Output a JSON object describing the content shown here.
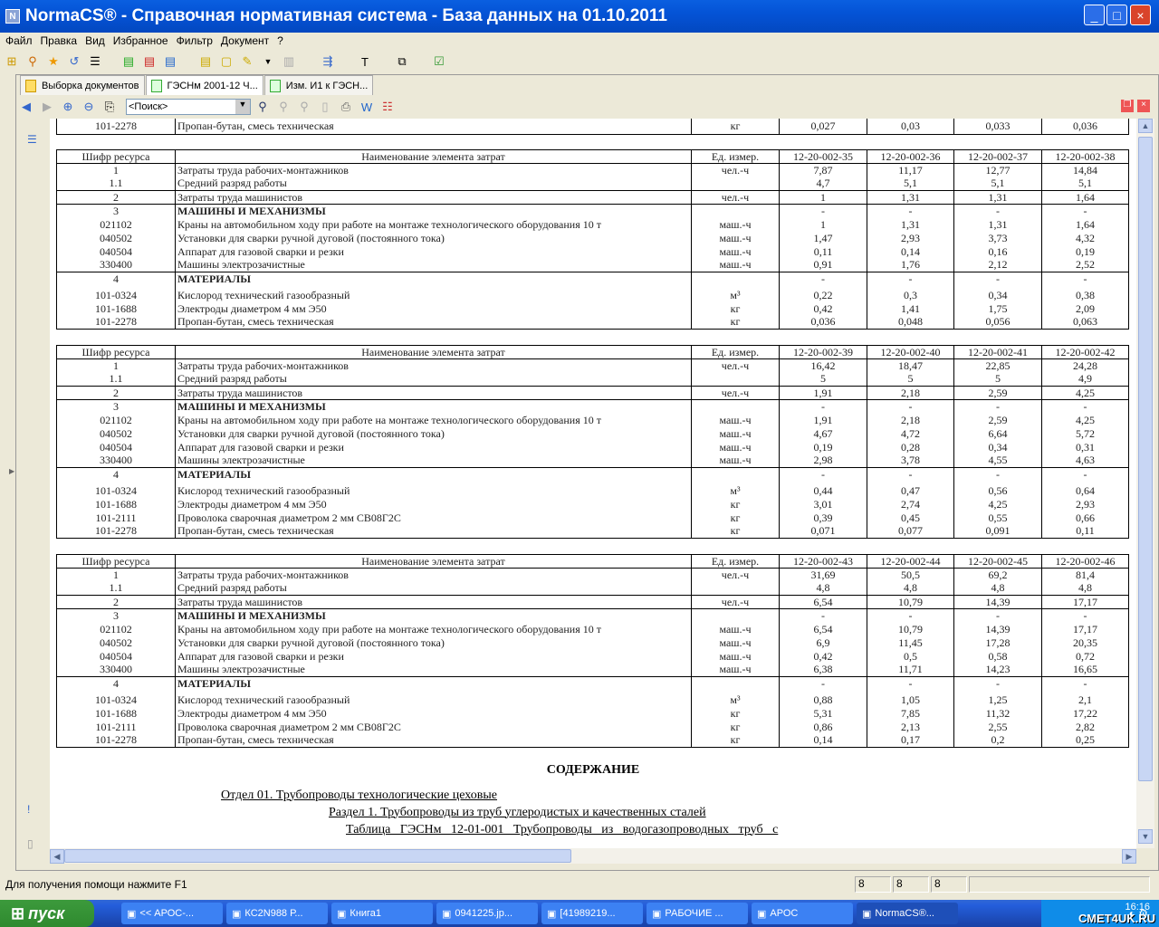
{
  "window": {
    "title": "NormaCS® - Справочная нормативная система - База данных на 01.10.2011",
    "minimize": "_",
    "maximize": "□",
    "close": "×"
  },
  "menu": [
    "Файл",
    "Правка",
    "Вид",
    "Избранное",
    "Фильтр",
    "Документ",
    "?"
  ],
  "tabs": [
    "Выборка документов",
    "ГЭСНм 2001-12 Ч...",
    "Изм. И1  к ГЭСН..."
  ],
  "search": {
    "value": "<Поиск>"
  },
  "headers": {
    "code": "Шифр ресурса",
    "name": "Наименование элемента затрат",
    "unit": "Ед. измер."
  },
  "partial_row": {
    "code": "101-2278",
    "name": "Пропан-бутан, смесь техническая",
    "unit": "кг",
    "vals": [
      "0,027",
      "0,03",
      "0,033",
      "0,036"
    ]
  },
  "blocks": [
    {
      "codes": [
        "12-20-002-35",
        "12-20-002-36",
        "12-20-002-37",
        "12-20-002-38"
      ],
      "groups": [
        [
          {
            "code": "1",
            "name": "Затраты труда рабочих-монтажников",
            "unit": "чел.-ч",
            "vals": [
              "7,87",
              "11,17",
              "12,77",
              "14,84"
            ]
          },
          {
            "code": "1.1",
            "name": "Средний разряд работы",
            "unit": "",
            "vals": [
              "4,7",
              "5,1",
              "5,1",
              "5,1"
            ]
          }
        ],
        [
          {
            "code": "2",
            "name": "Затраты труда машинистов",
            "unit": "чел.-ч",
            "vals": [
              "1",
              "1,31",
              "1,31",
              "1,64"
            ]
          }
        ],
        [
          {
            "code": "3",
            "name": "МАШИНЫ И МЕХАНИЗМЫ",
            "unit": "",
            "bold": true,
            "vals": [
              "-",
              "-",
              "-",
              "-"
            ]
          },
          {
            "code": "021102",
            "name": "Краны на автомобильном ходу при работе на монтаже технологического оборудования 10 т",
            "unit": "маш.-ч",
            "vals": [
              "1",
              "1,31",
              "1,31",
              "1,64"
            ]
          },
          {
            "code": "040502",
            "name": "Установки для сварки ручной дуговой (постоянного тока)",
            "unit": "маш.-ч",
            "vals": [
              "1,47",
              "2,93",
              "3,73",
              "4,32"
            ]
          },
          {
            "code": "040504",
            "name": "Аппарат для газовой сварки и резки",
            "unit": "маш.-ч",
            "vals": [
              "0,11",
              "0,14",
              "0,16",
              "0,19"
            ]
          },
          {
            "code": "330400",
            "name": "Машины электрозачистные",
            "unit": "маш.-ч",
            "vals": [
              "0,91",
              "1,76",
              "2,12",
              "2,52"
            ]
          }
        ],
        [
          {
            "code": "4",
            "name": "МАТЕРИАЛЫ",
            "unit": "",
            "bold": true,
            "vals": [
              "-",
              "-",
              "-",
              "-"
            ]
          },
          {
            "code": "101-0324",
            "name": "Кислород технический газообразный",
            "unit": "м³",
            "tall": true,
            "vals": [
              "0,22",
              "0,3",
              "0,34",
              "0,38"
            ]
          },
          {
            "code": "101-1688",
            "name": "Электроды диаметром 4 мм Э50",
            "unit": "кг",
            "vals": [
              "0,42",
              "1,41",
              "1,75",
              "2,09"
            ]
          },
          {
            "code": "101-2278",
            "name": "Пропан-бутан, смесь техническая",
            "unit": "кг",
            "vals": [
              "0,036",
              "0,048",
              "0,056",
              "0,063"
            ]
          }
        ]
      ]
    },
    {
      "codes": [
        "12-20-002-39",
        "12-20-002-40",
        "12-20-002-41",
        "12-20-002-42"
      ],
      "groups": [
        [
          {
            "code": "1",
            "name": "Затраты труда рабочих-монтажников",
            "unit": "чел.-ч",
            "vals": [
              "16,42",
              "18,47",
              "22,85",
              "24,28"
            ]
          },
          {
            "code": "1.1",
            "name": "Средний разряд работы",
            "unit": "",
            "vals": [
              "5",
              "5",
              "5",
              "4,9"
            ]
          }
        ],
        [
          {
            "code": "2",
            "name": "Затраты труда машинистов",
            "unit": "чел.-ч",
            "vals": [
              "1,91",
              "2,18",
              "2,59",
              "4,25"
            ]
          }
        ],
        [
          {
            "code": "3",
            "name": "МАШИНЫ И МЕХАНИЗМЫ",
            "unit": "",
            "bold": true,
            "vals": [
              "-",
              "-",
              "-",
              "-"
            ]
          },
          {
            "code": "021102",
            "name": "Краны на автомобильном ходу при работе на монтаже технологического оборудования 10 т",
            "unit": "маш.-ч",
            "vals": [
              "1,91",
              "2,18",
              "2,59",
              "4,25"
            ]
          },
          {
            "code": "040502",
            "name": "Установки для сварки ручной дуговой (постоянного тока)",
            "unit": "маш.-ч",
            "vals": [
              "4,67",
              "4,72",
              "6,64",
              "5,72"
            ]
          },
          {
            "code": "040504",
            "name": "Аппарат для газовой сварки и резки",
            "unit": "маш.-ч",
            "vals": [
              "0,19",
              "0,28",
              "0,34",
              "0,31"
            ]
          },
          {
            "code": "330400",
            "name": "Машины электрозачистные",
            "unit": "маш.-ч",
            "vals": [
              "2,98",
              "3,78",
              "4,55",
              "4,63"
            ]
          }
        ],
        [
          {
            "code": "4",
            "name": "МАТЕРИАЛЫ",
            "unit": "",
            "bold": true,
            "vals": [
              "-",
              "-",
              "-",
              "-"
            ]
          },
          {
            "code": "101-0324",
            "name": "Кислород технический газообразный",
            "unit": "м³",
            "tall": true,
            "vals": [
              "0,44",
              "0,47",
              "0,56",
              "0,64"
            ]
          },
          {
            "code": "101-1688",
            "name": "Электроды диаметром 4 мм Э50",
            "unit": "кг",
            "vals": [
              "3,01",
              "2,74",
              "4,25",
              "2,93"
            ]
          },
          {
            "code": "101-2111",
            "name": "Проволока сварочная диаметром 2 мм СВ08Г2С",
            "unit": "кг",
            "vals": [
              "0,39",
              "0,45",
              "0,55",
              "0,66"
            ]
          },
          {
            "code": "101-2278",
            "name": "Пропан-бутан, смесь техническая",
            "unit": "кг",
            "vals": [
              "0,071",
              "0,077",
              "0,091",
              "0,11"
            ]
          }
        ]
      ]
    },
    {
      "codes": [
        "12-20-002-43",
        "12-20-002-44",
        "12-20-002-45",
        "12-20-002-46"
      ],
      "groups": [
        [
          {
            "code": "1",
            "name": "Затраты труда рабочих-монтажников",
            "unit": "чел.-ч",
            "vals": [
              "31,69",
              "50,5",
              "69,2",
              "81,4"
            ]
          },
          {
            "code": "1.1",
            "name": "Средний разряд работы",
            "unit": "",
            "vals": [
              "4,8",
              "4,8",
              "4,8",
              "4,8"
            ]
          }
        ],
        [
          {
            "code": "2",
            "name": "Затраты труда машинистов",
            "unit": "чел.-ч",
            "vals": [
              "6,54",
              "10,79",
              "14,39",
              "17,17"
            ]
          }
        ],
        [
          {
            "code": "3",
            "name": "МАШИНЫ И МЕХАНИЗМЫ",
            "unit": "",
            "bold": true,
            "vals": [
              "-",
              "-",
              "-",
              "-"
            ]
          },
          {
            "code": "021102",
            "name": "Краны на автомобильном ходу при работе на монтаже технологического оборудования 10 т",
            "unit": "маш.-ч",
            "vals": [
              "6,54",
              "10,79",
              "14,39",
              "17,17"
            ]
          },
          {
            "code": "040502",
            "name": "Установки для сварки ручной дуговой (постоянного тока)",
            "unit": "маш.-ч",
            "vals": [
              "6,9",
              "11,45",
              "17,28",
              "20,35"
            ]
          },
          {
            "code": "040504",
            "name": "Аппарат для газовой сварки и резки",
            "unit": "маш.-ч",
            "vals": [
              "0,42",
              "0,5",
              "0,58",
              "0,72"
            ]
          },
          {
            "code": "330400",
            "name": "Машины электрозачистные",
            "unit": "маш.-ч",
            "vals": [
              "6,38",
              "11,71",
              "14,23",
              "16,65"
            ]
          }
        ],
        [
          {
            "code": "4",
            "name": "МАТЕРИАЛЫ",
            "unit": "",
            "bold": true,
            "vals": [
              "-",
              "-",
              "-",
              "-"
            ]
          },
          {
            "code": "101-0324",
            "name": "Кислород технический газообразный",
            "unit": "м³",
            "tall": true,
            "vals": [
              "0,88",
              "1,05",
              "1,25",
              "2,1"
            ]
          },
          {
            "code": "101-1688",
            "name": "Электроды диаметром 4 мм Э50",
            "unit": "кг",
            "vals": [
              "5,31",
              "7,85",
              "11,32",
              "17,22"
            ]
          },
          {
            "code": "101-2111",
            "name": "Проволока сварочная диаметром 2 мм СВ08Г2С",
            "unit": "кг",
            "vals": [
              "0,86",
              "2,13",
              "2,55",
              "2,82"
            ]
          },
          {
            "code": "101-2278",
            "name": "Пропан-бутан, смесь техническая",
            "unit": "кг",
            "vals": [
              "0,14",
              "0,17",
              "0,2",
              "0,25"
            ]
          }
        ]
      ]
    }
  ],
  "toc": {
    "heading": "СОДЕРЖАНИЕ",
    "links": [
      "Отдел 01. Трубопроводы технологические цеховые",
      "Раздел 1. Трубопроводы из труб углеродистых и качественных сталей",
      "Таблица   ГЭСНм   12-01-001   Трубопроводы   из   водогазопроводных   труб   с"
    ]
  },
  "status": {
    "text": "Для получения помощи нажмите F1",
    "panes": [
      "8",
      "8",
      "8"
    ]
  },
  "taskbar": {
    "start": "пуск",
    "tasks": [
      "<< АРОС-...",
      "КС2N988 Р...",
      "Книга1",
      "0941225.jp...",
      "[41989219...",
      "РАБОЧИЕ ...",
      "АРОС",
      "NormaCS®..."
    ],
    "clock": "16:16",
    "watermark": "СМЕТ4UK.RU"
  }
}
